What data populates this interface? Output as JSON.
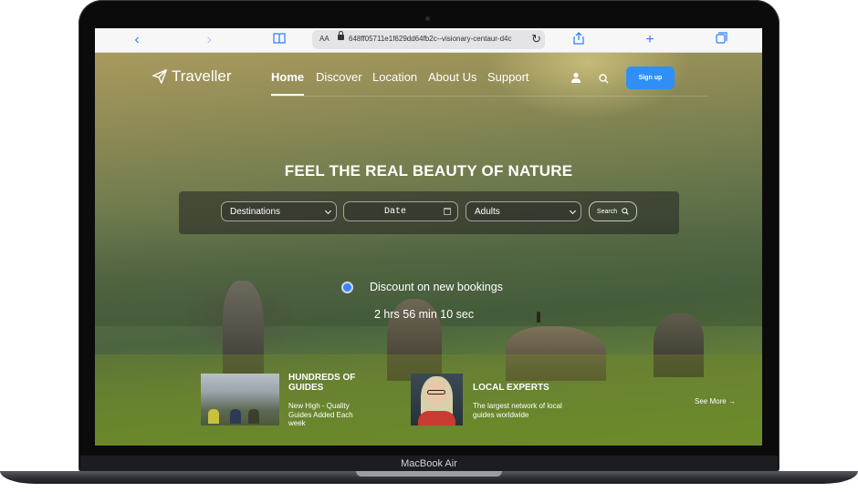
{
  "device": {
    "label": "MacBook Air"
  },
  "browser": {
    "url_aa": "AA",
    "url": "648ff05711e1f629dd64fb2c--visionary-centaur-d4c"
  },
  "nav": {
    "brand": "Traveller",
    "links": [
      "Home",
      "Discover",
      "Location",
      "About Us",
      "Support"
    ],
    "active": "Home",
    "signup": "Sign up"
  },
  "hero": {
    "headline": "FEEL THE REAL BEAUTY OF NATURE"
  },
  "search": {
    "destination": "Destinations",
    "date": "Date",
    "adults": "Adults",
    "button": "Search"
  },
  "promo": {
    "discount": "Discount on new bookings",
    "countdown": "2 hrs 56 min 10 sec"
  },
  "features": [
    {
      "title": "HUNDREDS OF GUIDES",
      "description": "New High - Quality Guides Added Each week"
    },
    {
      "title": "LOCAL EXPERTS",
      "description": "The largest network of local guides worldwide"
    }
  ],
  "see_more": "See More",
  "colors": {
    "signup_bg": "#2f8ff7",
    "radio": "#3b82f6",
    "safari_accent": "#2f7bf5"
  }
}
